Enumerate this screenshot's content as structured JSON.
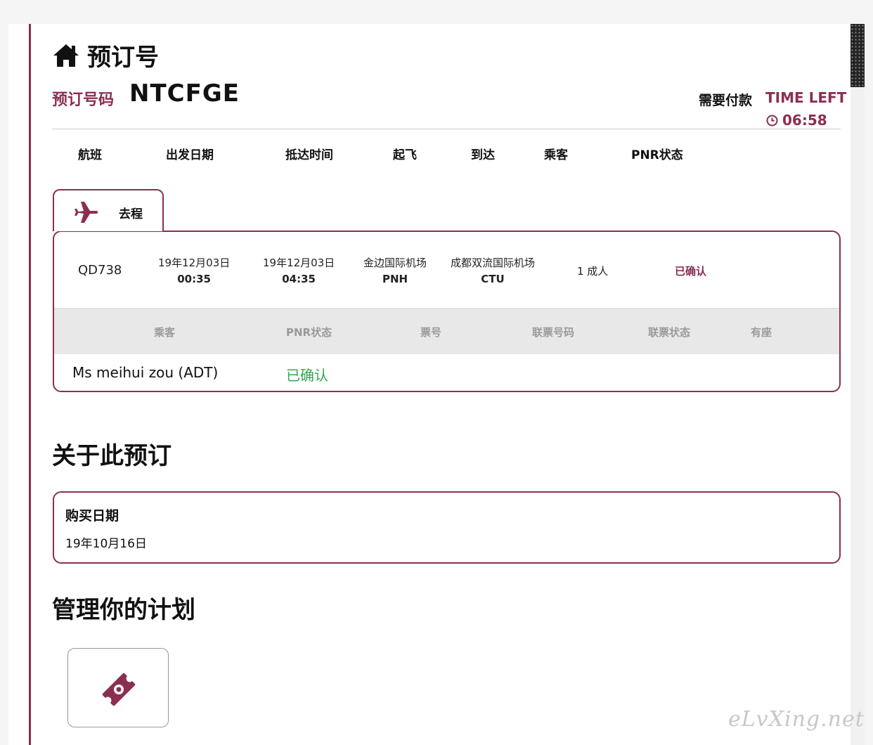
{
  "header": {
    "title": "预订号",
    "title_icon": "home-icon",
    "booking_ref_label": "预订号码",
    "booking_ref": "NTCFGE",
    "payment_required_label": "需要付款",
    "time_left_label": "TIME LEFT",
    "countdown": "06:58"
  },
  "columns": [
    "航班",
    "出发日期",
    "抵达时间",
    "起飞",
    "到达",
    "乘客",
    "PNR状态"
  ],
  "trip_tab": {
    "label": "去程",
    "icon": "airplane-icon"
  },
  "flight": {
    "flight_no": "QD738",
    "departure_date": "19年12月03日",
    "departure_time": "00:35",
    "arrival_date": "19年12月03日",
    "arrival_time": "04:35",
    "origin_name": "金边国际机场",
    "origin_code": "PNH",
    "dest_name": "成都双流国际机场",
    "dest_code": "CTU",
    "passengers": "1 成人",
    "pnr_status": "已确认"
  },
  "passenger_table": {
    "headers": [
      "乘客",
      "PNR状态",
      "票号",
      "联票号码",
      "联票状态",
      "有座"
    ],
    "rows": [
      {
        "name": "Ms meihui zou (ADT)",
        "pnr_status": "已确认"
      }
    ]
  },
  "about": {
    "title": "关于此预订",
    "purchase_date_label": "购买日期",
    "purchase_date": "19年10月16日"
  },
  "manage": {
    "title": "管理你的计划",
    "button_icon": "ticket-icon"
  },
  "watermark": "eLvXing.net",
  "colors": {
    "brand": "#8b2e52",
    "confirmed": "#2fa84f",
    "header_gray": "#e8e8e8"
  }
}
